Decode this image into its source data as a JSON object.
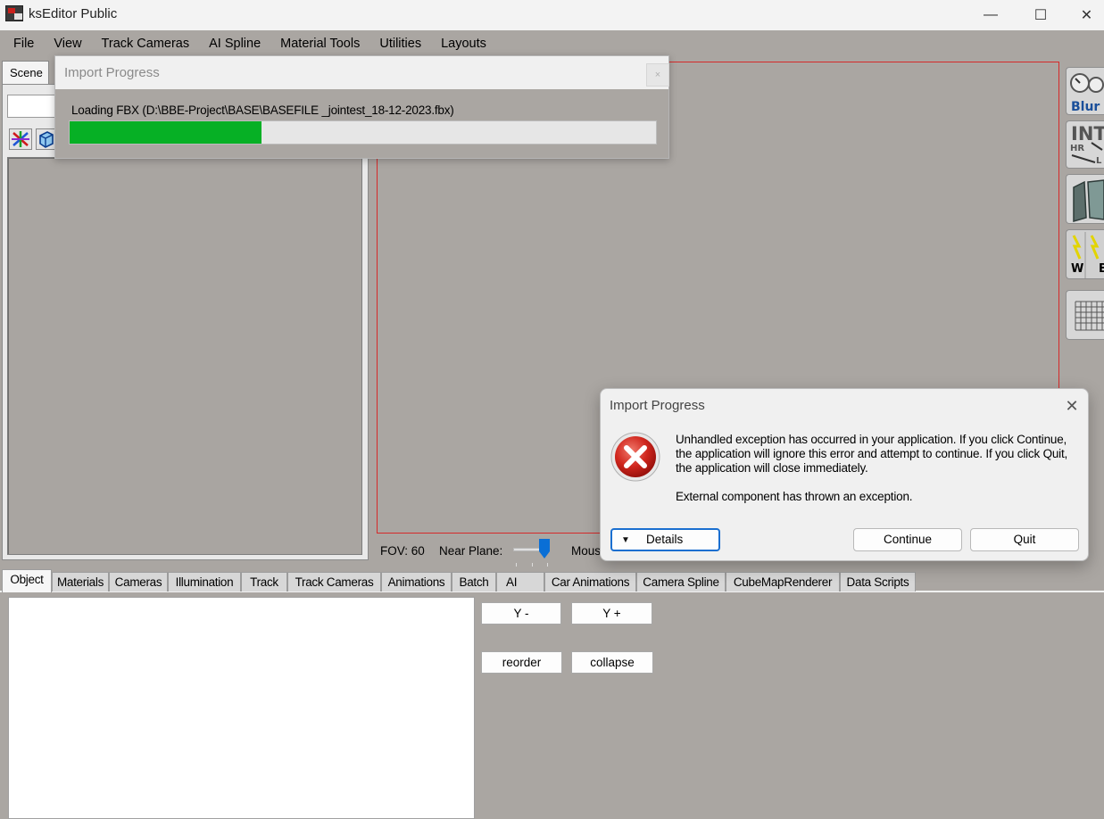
{
  "window": {
    "title": "ksEditor Public",
    "minimize": "—",
    "maximize": "☐",
    "close": "✕"
  },
  "menu": [
    "File",
    "View",
    "Track Cameras",
    "AI Spline",
    "Material Tools",
    "Utilities",
    "Layouts"
  ],
  "scene": {
    "tab_label": "Scene"
  },
  "viewport": {
    "fov": "FOV: 60",
    "near_plane_label": "Near Plane:",
    "near_plane_level": 0.75,
    "mouse_label": "Mous"
  },
  "right_toolbar": {
    "items": [
      "Blur",
      "INT",
      "HR",
      "L",
      "W",
      "B"
    ]
  },
  "bottom_tabs": [
    "Object",
    "Materials",
    "Cameras",
    "Illumination",
    "Track",
    "Track Cameras",
    "Animations",
    "Batch",
    "AI",
    "Car Animations",
    "Camera Spline",
    "CubeMapRenderer",
    "Data Scripts"
  ],
  "object_panel": {
    "buttons": [
      "Y -",
      "Y +",
      "reorder",
      "collapse"
    ]
  },
  "import_progress": {
    "title": "Import Progress",
    "close": "×",
    "message": "Loading FBX (D:\\BBE-Project\\BASE\\BASEFILE _jointest_18-12-2023.fbx)",
    "progress": 0.328
  },
  "error_dialog": {
    "title": "Import Progress",
    "close": "✕",
    "message": "Unhandled exception has occurred in your application. If you click Continue, the application will ignore this error and attempt to continue. If you click Quit, the application will close immediately.",
    "detail": "External component has thrown an exception.",
    "details_label": "Details",
    "details_arrow": "▼",
    "continue_label": "Continue",
    "quit_label": "Quit"
  },
  "colors": {
    "panel_gray": "#aaa6a2",
    "progress_green": "#06b025",
    "viewport_border": "#d52a2a",
    "focus_blue": "#1a6fd0",
    "error_red": "#c8201c"
  }
}
